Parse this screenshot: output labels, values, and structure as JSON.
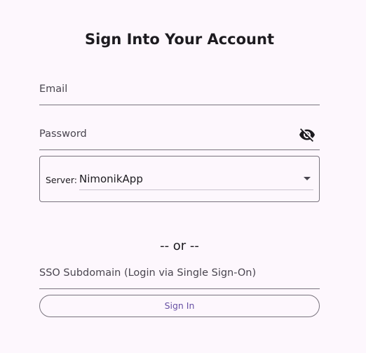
{
  "title": "Sign Into Your Account",
  "form": {
    "email_label": "Email",
    "password_label": "Password",
    "password_visibility_icon": "eye-off-icon",
    "server_prefix": "Server:",
    "server_value": "NimonikApp",
    "or_text": "-- or --",
    "sso_label": "SSO Subdomain (Login via Single Sign-On)",
    "signin_label": "Sign In"
  },
  "colors": {
    "background": "#fdf7fd",
    "accent": "#6750a4",
    "outline": "#79747e"
  }
}
